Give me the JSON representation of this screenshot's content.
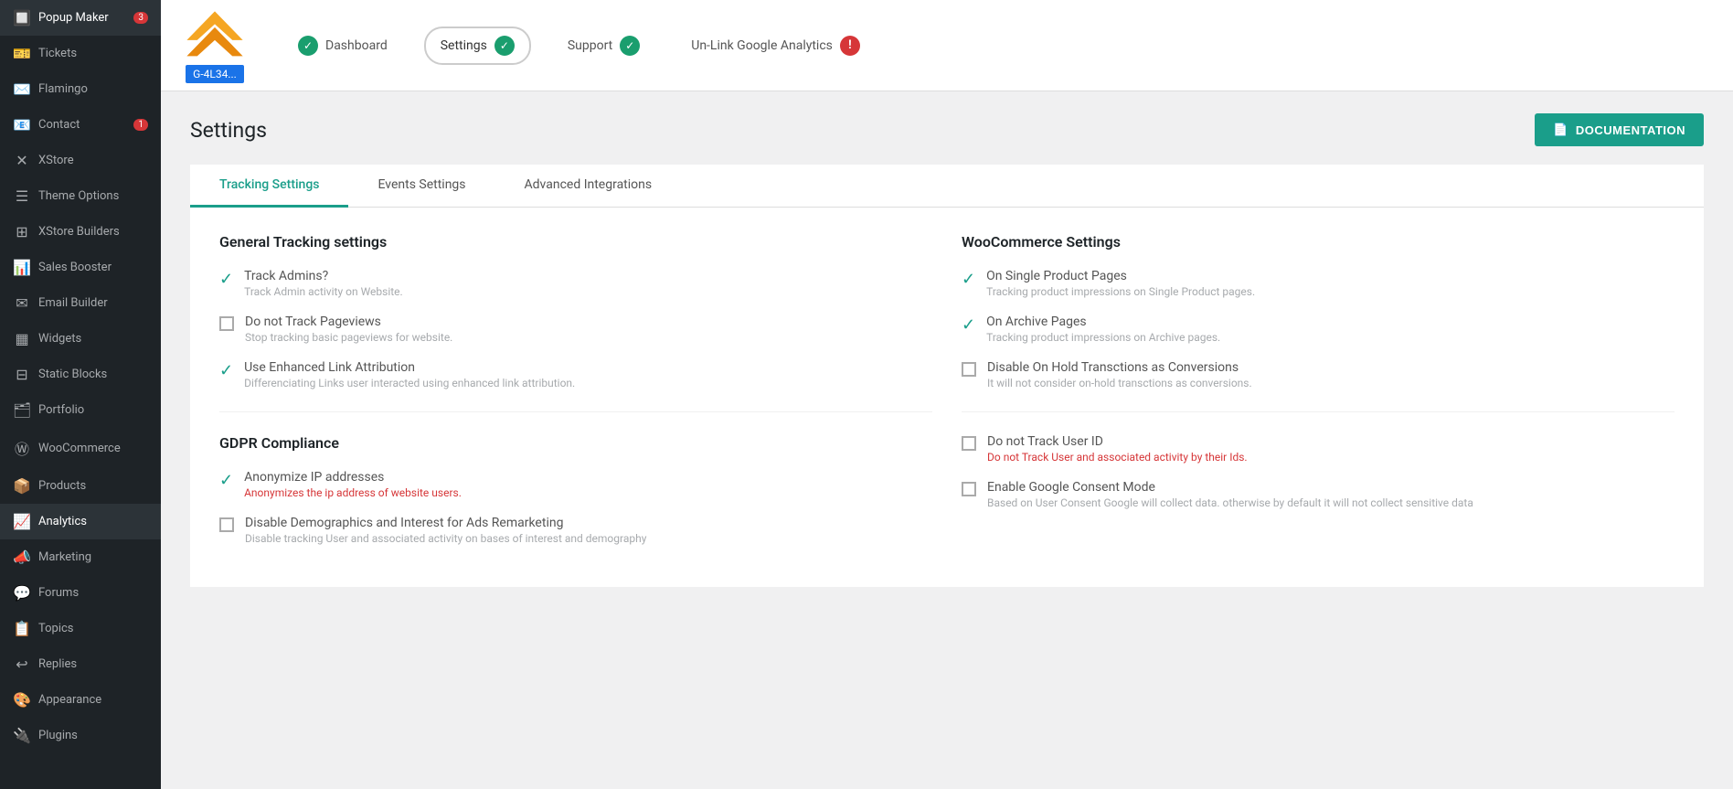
{
  "sidebar": {
    "items": [
      {
        "id": "popup-maker",
        "label": "Popup Maker",
        "icon": "🔲",
        "badge": "3"
      },
      {
        "id": "tickets",
        "label": "Tickets",
        "icon": "🎫",
        "badge": null
      },
      {
        "id": "flamingo",
        "label": "Flamingo",
        "icon": "✉️",
        "badge": null
      },
      {
        "id": "contact",
        "label": "Contact",
        "icon": "📧",
        "badge": "1"
      },
      {
        "id": "xstore",
        "label": "XStore",
        "icon": "✕",
        "badge": null
      },
      {
        "id": "theme-options",
        "label": "Theme Options",
        "icon": "☰",
        "badge": null
      },
      {
        "id": "xstore-builders",
        "label": "XStore Builders",
        "icon": "⊞",
        "badge": null
      },
      {
        "id": "sales-booster",
        "label": "Sales Booster",
        "icon": "📊",
        "badge": null
      },
      {
        "id": "email-builder",
        "label": "Email Builder",
        "icon": "✉",
        "badge": null
      },
      {
        "id": "widgets",
        "label": "Widgets",
        "icon": "▦",
        "badge": null
      },
      {
        "id": "static-blocks",
        "label": "Static Blocks",
        "icon": "⊟",
        "badge": null
      },
      {
        "id": "portfolio",
        "label": "Portfolio",
        "icon": "🗂",
        "badge": null
      },
      {
        "id": "woocommerce",
        "label": "WooCommerce",
        "icon": "Ⓦ",
        "badge": null
      },
      {
        "id": "products",
        "label": "Products",
        "icon": "📦",
        "badge": null
      },
      {
        "id": "analytics",
        "label": "Analytics",
        "icon": "📈",
        "badge": null
      },
      {
        "id": "marketing",
        "label": "Marketing",
        "icon": "📣",
        "badge": null
      },
      {
        "id": "forums",
        "label": "Forums",
        "icon": "💬",
        "badge": null
      },
      {
        "id": "topics",
        "label": "Topics",
        "icon": "📋",
        "badge": null
      },
      {
        "id": "replies",
        "label": "Replies",
        "icon": "↩",
        "badge": null
      },
      {
        "id": "appearance",
        "label": "Appearance",
        "icon": "🎨",
        "badge": null
      },
      {
        "id": "plugins",
        "label": "Plugins",
        "icon": "🔌",
        "badge": null
      }
    ]
  },
  "topbar": {
    "tracking_id": "G-4L34...",
    "nav_items": [
      {
        "id": "dashboard",
        "label": "Dashboard",
        "status": "check"
      },
      {
        "id": "settings",
        "label": "Settings",
        "status": "check",
        "active": true
      },
      {
        "id": "support",
        "label": "Support",
        "status": "check"
      },
      {
        "id": "unlink",
        "label": "Un-Link Google Analytics",
        "status": "exclaim"
      }
    ]
  },
  "page": {
    "title": "Settings",
    "doc_button": "DOCUMENTATION"
  },
  "tabs": [
    {
      "id": "tracking",
      "label": "Tracking Settings",
      "active": true
    },
    {
      "id": "events",
      "label": "Events Settings",
      "active": false
    },
    {
      "id": "advanced",
      "label": "Advanced Integrations",
      "active": false
    }
  ],
  "general_tracking": {
    "title": "General Tracking settings",
    "items": [
      {
        "checked": true,
        "label": "Track Admins?",
        "desc": "Track Admin activity on Website.",
        "type": "check"
      },
      {
        "checked": false,
        "label": "Do not Track Pageviews",
        "desc": "Stop tracking basic pageviews for website.",
        "type": "checkbox"
      },
      {
        "checked": true,
        "label": "Use Enhanced Link Attribution",
        "desc": "Differenciating Links user interacted using enhanced link attribution.",
        "type": "check"
      }
    ]
  },
  "gdpr": {
    "title": "GDPR Compliance",
    "items": [
      {
        "checked": true,
        "label": "Anonymize IP addresses",
        "desc": "Anonymizes the ip address of website users.",
        "type": "check"
      },
      {
        "checked": false,
        "label": "Disable Demographics and Interest for Ads Remarketing",
        "desc": "Disable tracking User and associated activity on bases of interest and demography",
        "type": "checkbox"
      }
    ]
  },
  "woocommerce": {
    "title": "WooCommerce Settings",
    "items": [
      {
        "checked": true,
        "label": "On Single Product Pages",
        "desc": "Tracking product impressions on Single Product pages.",
        "type": "check"
      },
      {
        "checked": true,
        "label": "On Archive Pages",
        "desc": "Tracking product impressions on Archive pages.",
        "type": "check"
      },
      {
        "checked": false,
        "label": "Disable On Hold Transctions as Conversions",
        "desc": "It will not consider on-hold transctions as conversions.",
        "type": "checkbox"
      }
    ]
  },
  "right_gdpr": {
    "items": [
      {
        "checked": false,
        "label": "Do not Track User ID",
        "desc": "Do not Track User and associated activity by their Ids.",
        "type": "checkbox"
      },
      {
        "checked": false,
        "label": "Enable Google Consent Mode",
        "desc": "Based on User Consent Google will collect data. otherwise by default it will not collect sensitive data",
        "type": "checkbox"
      }
    ]
  },
  "colors": {
    "teal": "#1a9e8a",
    "sidebar_bg": "#1e2327",
    "badge_red": "#d63638"
  }
}
